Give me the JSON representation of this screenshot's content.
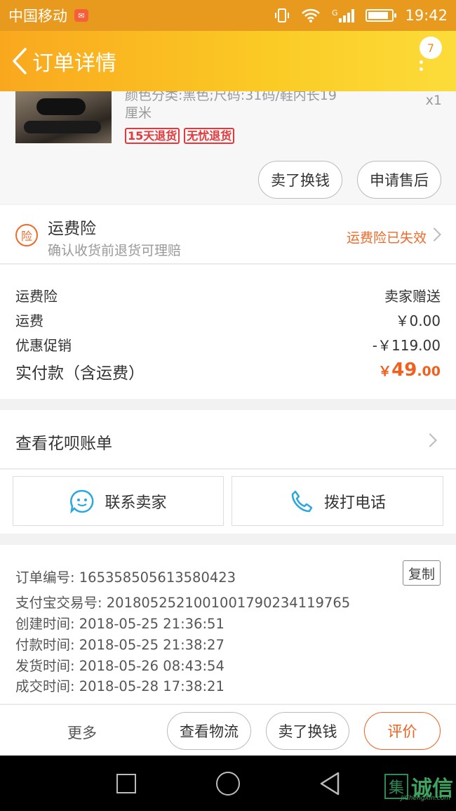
{
  "status_bar": {
    "carrier": "中国移动",
    "network": "G",
    "time": "19:42"
  },
  "header": {
    "title": "订单详情",
    "message_count": "7"
  },
  "product": {
    "spec": "颜色分类:黑色;尺码:31码/鞋内长19厘米",
    "quantity": "x1",
    "tags": [
      "15天退货",
      "无忧退货"
    ],
    "actions": [
      "卖了换钱",
      "申请售后"
    ]
  },
  "insurance": {
    "icon_char": "险",
    "title": "运费险",
    "subtitle": "确认收货前退货可理赔",
    "status": "运费险已失效"
  },
  "fees": [
    {
      "label": "运费险",
      "value": "卖家赠送"
    },
    {
      "label": "运费",
      "value": "￥0.00"
    },
    {
      "label": "优惠促销",
      "value": "-￥119.00"
    }
  ],
  "total": {
    "label": "实付款（含运费）",
    "currency": "￥",
    "integer": "49",
    "decimal": ".00"
  },
  "huabei": {
    "label": "查看花呗账单"
  },
  "contact": {
    "seller_label": "联系卖家",
    "phone_label": "拨打电话"
  },
  "order_info": {
    "copy_label": "复制",
    "rows": [
      "订单编号: 1653585056135804​23",
      "支付宝交易号: 2018052521001001790234119765",
      "创建时间: 2018-05-25 21:36:51",
      "付款时间: 2018-05-25 21:38:27",
      "发货时间: 2018-05-26 08:43:54",
      "成交时间: 2018-05-28 17:38:21"
    ]
  },
  "action_bar": {
    "more": "更多",
    "logistics": "查看物流",
    "resell": "卖了换钱",
    "review": "评价"
  },
  "watermark": {
    "box_char": "集",
    "text": "诚信",
    "sub": "JiChengXin.com"
  },
  "colors": {
    "accent": "#f0611f",
    "header_start": "#f9a81e",
    "header_end": "#fcdc3a"
  }
}
